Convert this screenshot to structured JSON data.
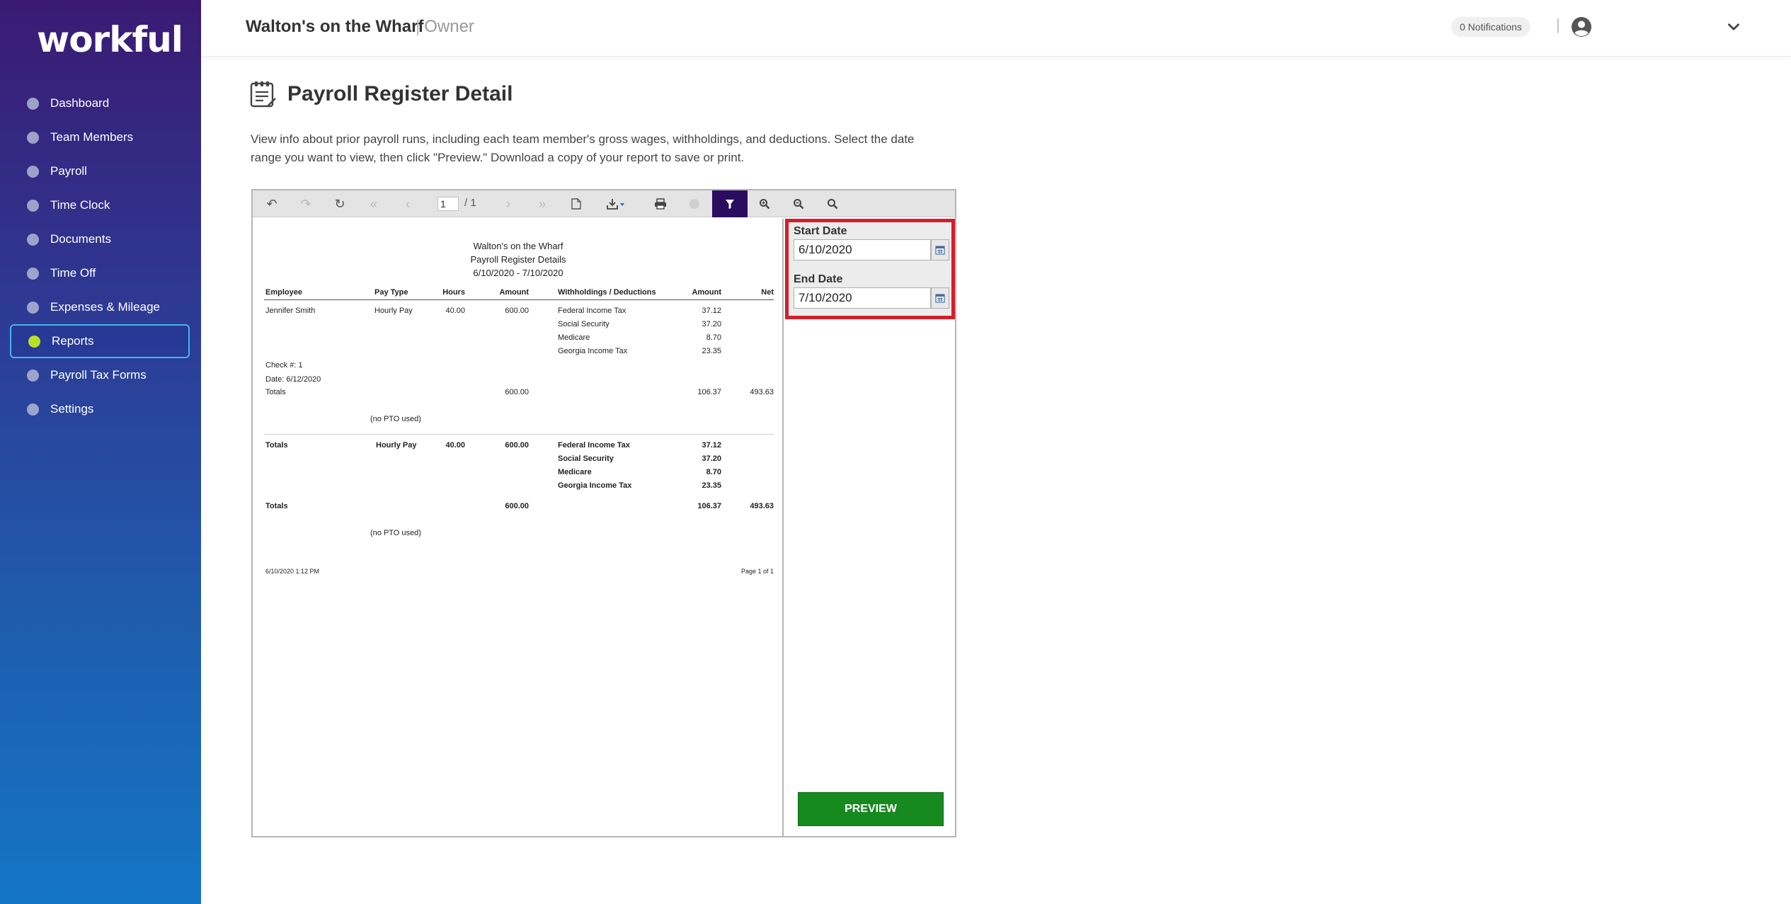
{
  "sidebar": {
    "logo": "workful",
    "items": [
      {
        "label": "Dashboard"
      },
      {
        "label": "Team Members"
      },
      {
        "label": "Payroll"
      },
      {
        "label": "Time Clock"
      },
      {
        "label": "Documents"
      },
      {
        "label": "Time Off"
      },
      {
        "label": "Expenses & Mileage"
      },
      {
        "label": "Reports",
        "active": true
      },
      {
        "label": "Payroll Tax Forms"
      },
      {
        "label": "Settings"
      }
    ]
  },
  "header": {
    "company": "Walton's on the Wharf",
    "separator": "|",
    "role": "Owner",
    "notifications": "0 Notifications",
    "divider": "|"
  },
  "page": {
    "title": "Payroll Register Detail",
    "description": "View info about prior payroll runs, including each team member's gross wages, withholdings, and deductions. Select the date range you want to view, then click \"Preview.\" Download a copy of your report to save or print."
  },
  "viewer": {
    "toolbar": {
      "page_current": "1",
      "page_total": "/ 1"
    },
    "report": {
      "title_lines": [
        "Walton's on the Wharf",
        "Payroll Register Details",
        "6/10/2020 - 7/10/2020"
      ],
      "columns": [
        "Employee",
        "Pay Type",
        "Hours",
        "Amount",
        "Withholdings / Deductions",
        "Amount",
        "Net"
      ],
      "employee": {
        "name": "Jennifer Smith",
        "pay_type": "Hourly Pay",
        "hours": "40.00",
        "amount": "600.00",
        "withholdings": [
          {
            "name": "Federal Income Tax",
            "amount": "37.12"
          },
          {
            "name": "Social Security",
            "amount": "37.20"
          },
          {
            "name": "Medicare",
            "amount": "8.70"
          },
          {
            "name": "Georgia Income Tax",
            "amount": "23.35"
          }
        ],
        "check": "Check #: 1",
        "date": "Date: 6/12/2020",
        "totals_label": "Totals",
        "totals_amount": "600.00",
        "totals_withholding": "106.37",
        "totals_net": "493.63",
        "pto": "(no PTO used)"
      },
      "grand": {
        "label": "Totals",
        "pay_type": "Hourly Pay",
        "hours": "40.00",
        "amount": "600.00",
        "withholdings": [
          {
            "name": "Federal Income Tax",
            "amount": "37.12"
          },
          {
            "name": "Social Security",
            "amount": "37.20"
          },
          {
            "name": "Medicare",
            "amount": "8.70"
          },
          {
            "name": "Georgia Income Tax",
            "amount": "23.35"
          }
        ],
        "totals_label": "Totals",
        "totals_amount": "600.00",
        "totals_withholding": "106.37",
        "totals_net": "493.63",
        "pto": "(no PTO used)"
      },
      "footer_left": "6/10/2020  1:12 PM",
      "footer_right": "Page 1 of 1"
    },
    "params": {
      "start_label": "Start Date",
      "start_value": "6/10/2020",
      "end_label": "End Date",
      "end_value": "7/10/2020",
      "preview_button": "PREVIEW"
    }
  },
  "colors": {
    "sidebar_top": "#3a1a73",
    "sidebar_bottom": "#1475c7",
    "active_dot": "#b7e327",
    "active_border": "#44b7f0",
    "highlight_border": "#d0202c",
    "preview_button": "#16891f",
    "toolbar_active": "#2a0d5e"
  },
  "icons": {
    "back": "undo-icon",
    "forward": "redo-icon",
    "refresh": "refresh-icon",
    "first": "first-page-icon",
    "prev": "prev-page-icon",
    "next": "next-page-icon",
    "last": "last-page-icon",
    "document": "document-icon",
    "export": "export-icon",
    "print": "print-icon",
    "stop": "stop-icon",
    "filter": "filter-icon",
    "zoom_in": "zoom-in-icon",
    "zoom_out": "zoom-out-icon",
    "search": "search-icon"
  }
}
